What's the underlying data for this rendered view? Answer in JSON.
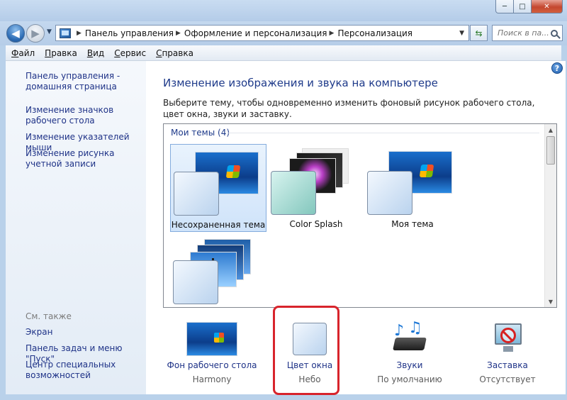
{
  "window": {
    "controls": {
      "minimize": "─",
      "maximize": "□",
      "close": "✕"
    }
  },
  "nav": {
    "back": "◀",
    "forward": "▶",
    "breadcrumbs": [
      "Панель управления",
      "Оформление и персонализация",
      "Персонализация"
    ],
    "search_placeholder": "Поиск в па..."
  },
  "menu": [
    "Файл",
    "Правка",
    "Вид",
    "Сервис",
    "Справка"
  ],
  "sidebar": {
    "links": [
      "Панель управления - домашняя страница",
      "Изменение значков рабочего стола",
      "Изменение указателей мыши",
      "Изменение рисунка учетной записи"
    ],
    "see_also_header": "См. также",
    "see_also": [
      "Экран",
      "Панель задач и меню \"Пуск\"",
      "Центр специальных возможностей"
    ]
  },
  "main": {
    "help": "?",
    "title": "Изменение изображения и звука на компьютере",
    "description": "Выберите тему, чтобы одновременно изменить фоновый рисунок рабочего стола, цвет окна, звуки и заставку.",
    "group_title": "Мои темы (4)",
    "themes": [
      {
        "label": "Несохраненная тема",
        "selected": true
      },
      {
        "label": "Color Splash",
        "selected": false
      },
      {
        "label": "Моя тема",
        "selected": false
      },
      {
        "label": "",
        "selected": false
      }
    ]
  },
  "bottom": [
    {
      "label": "Фон рабочего стола",
      "value": "Harmony"
    },
    {
      "label": "Цвет окна",
      "value": "Небо"
    },
    {
      "label": "Звуки",
      "value": "По умолчанию"
    },
    {
      "label": "Заставка",
      "value": "Отсутствует"
    }
  ],
  "colors": {
    "link": "#1e3287",
    "title": "#1e3a8a",
    "highlight": "#d8242c"
  }
}
